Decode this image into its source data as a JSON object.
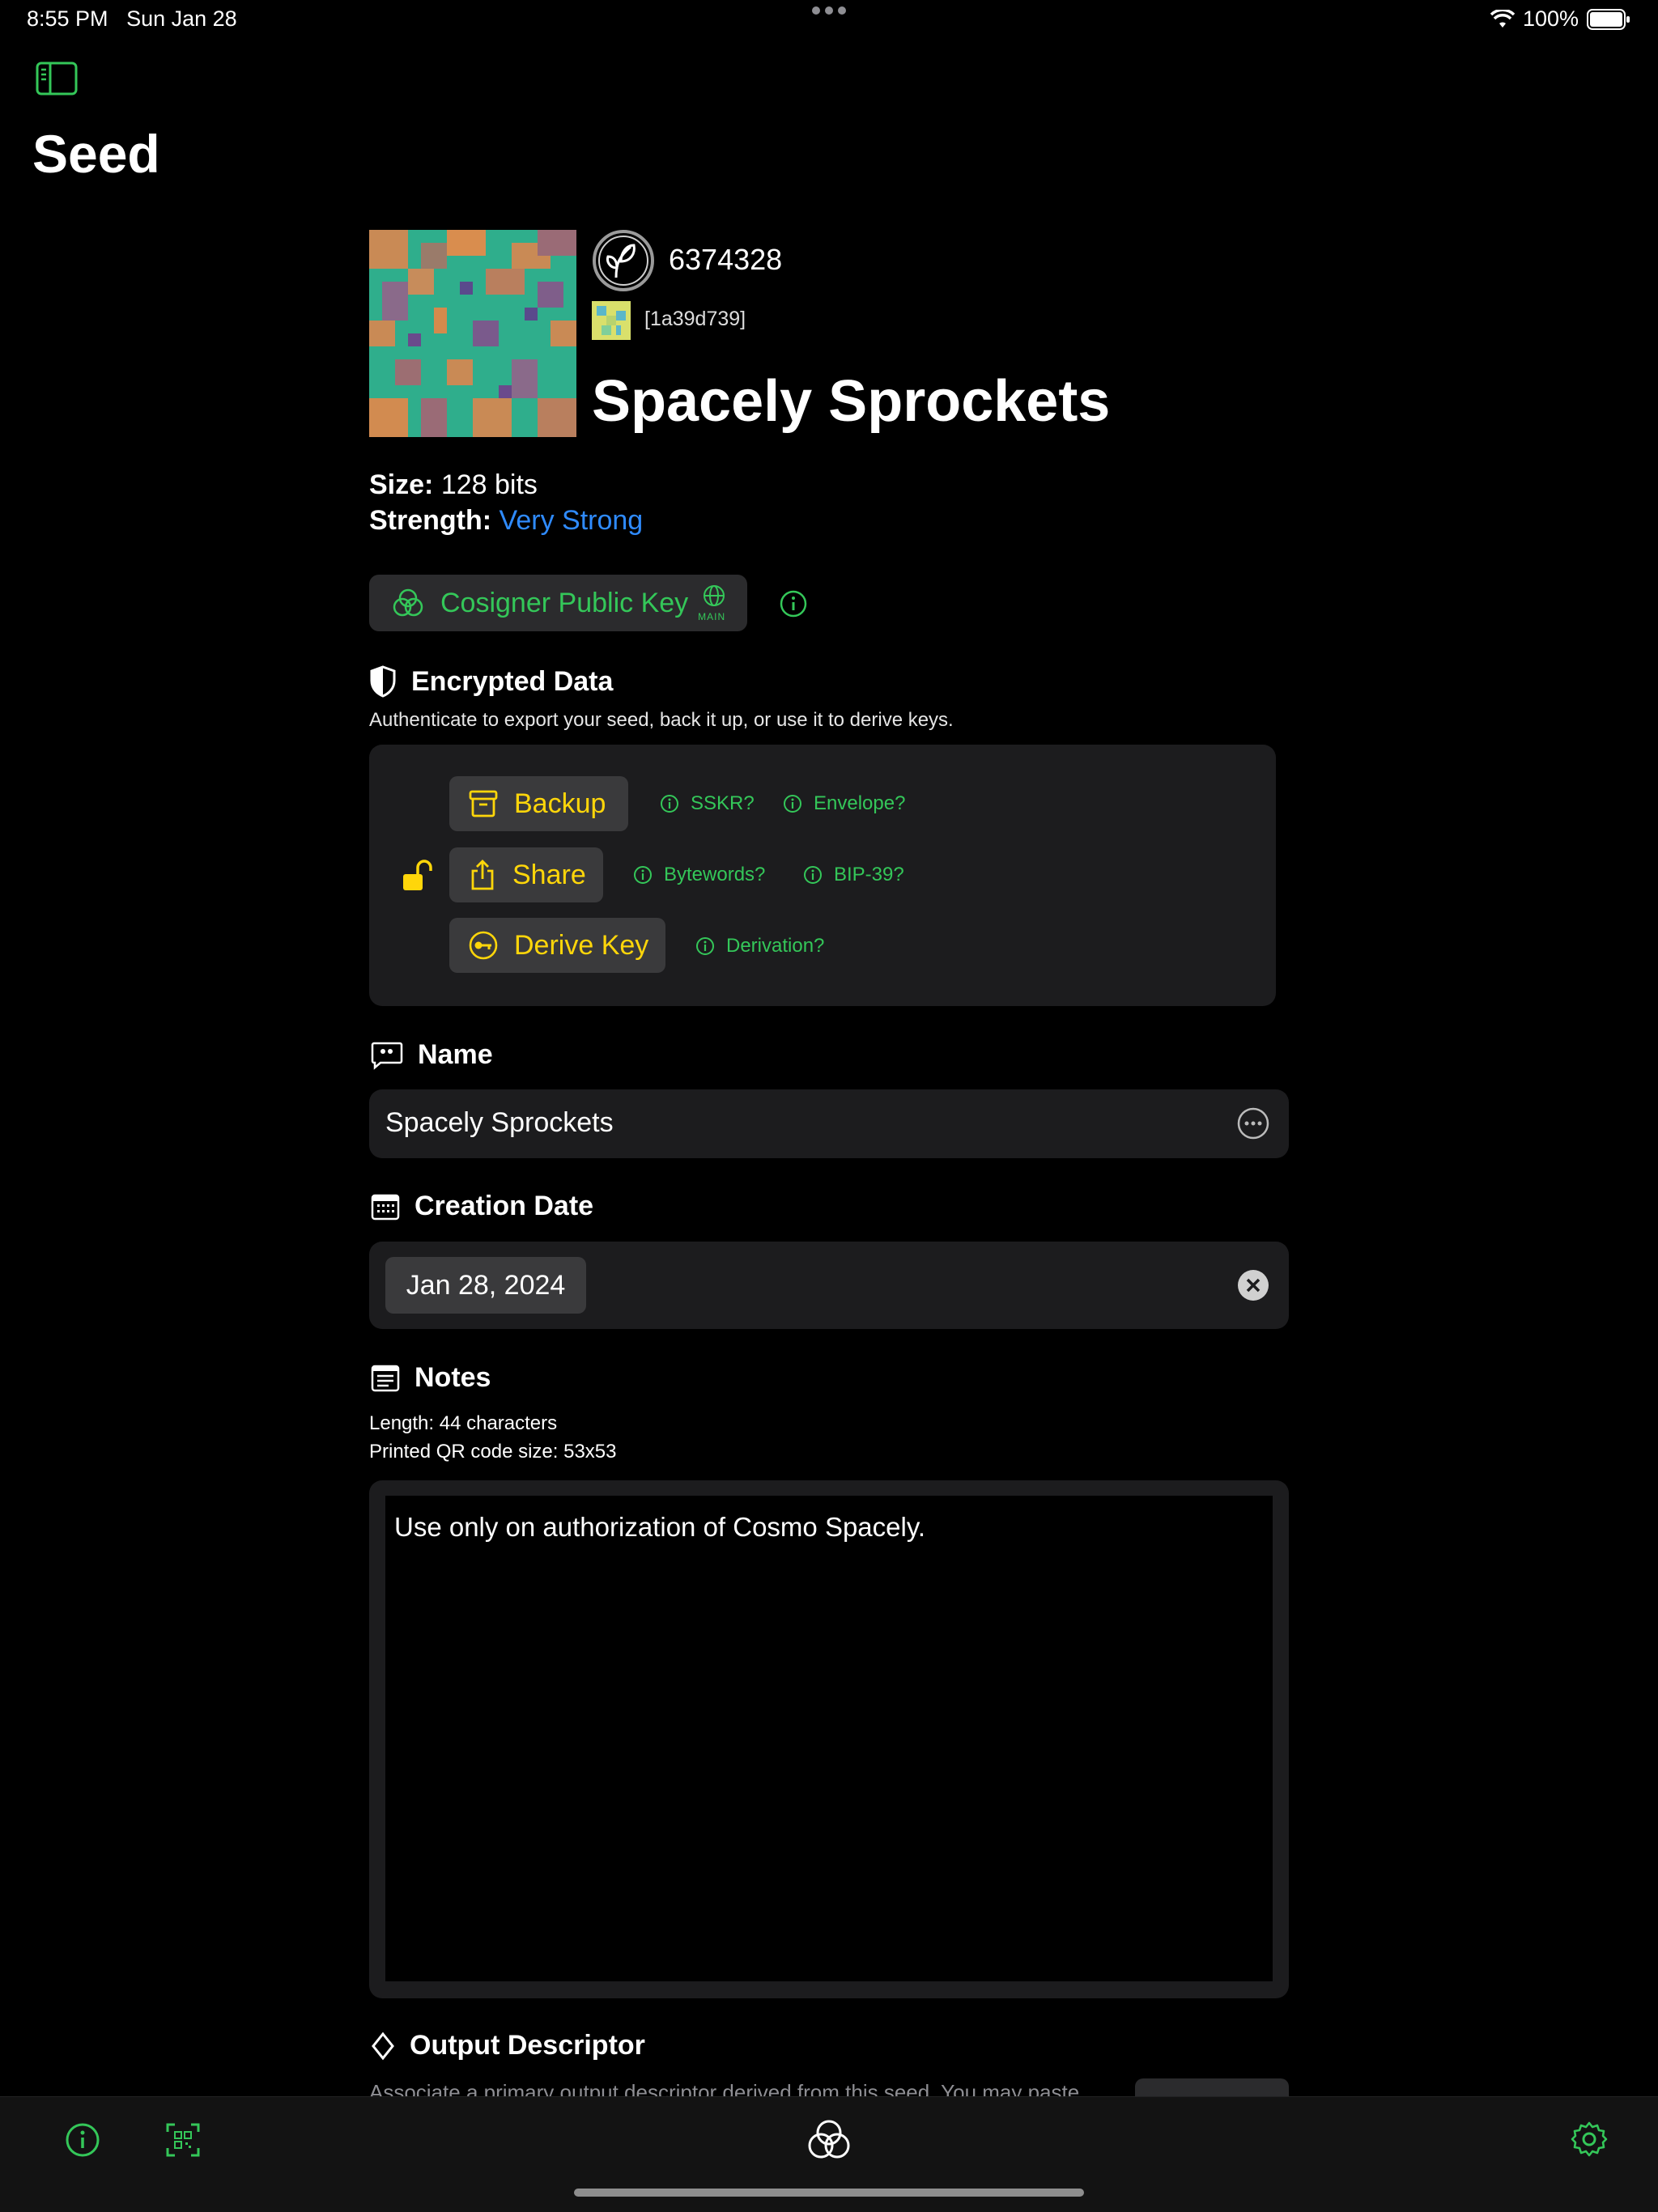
{
  "status_bar": {
    "time": "8:55 PM",
    "date": "Sun Jan 28",
    "battery": "100%"
  },
  "page": {
    "title": "Seed"
  },
  "seed": {
    "number": "6374328",
    "fingerprint": "[1a39d739]",
    "name": "Spacely Sprockets",
    "size_label": "Size:",
    "size_value": "128 bits",
    "strength_label": "Strength:",
    "strength_value": "Very Strong"
  },
  "cosigner": {
    "label": "Cosigner Public Key",
    "network": "MAIN"
  },
  "encrypted": {
    "title": "Encrypted Data",
    "subtitle": "Authenticate to export your seed, back it up, or use it to derive keys.",
    "actions": [
      {
        "label": "Backup",
        "hints": [
          "SSKR?",
          "Envelope?"
        ]
      },
      {
        "label": "Share",
        "hints": [
          "Bytewords?",
          "BIP-39?"
        ]
      },
      {
        "label": "Derive Key",
        "hints": [
          "Derivation?"
        ]
      }
    ]
  },
  "name_section": {
    "title": "Name",
    "value": "Spacely Sprockets"
  },
  "creation_date": {
    "title": "Creation Date",
    "value": "Jan 28, 2024"
  },
  "notes": {
    "title": "Notes",
    "length": "Length: 44 characters",
    "qr_size": "Printed QR code size: 53x53",
    "text": "Use only on authorization of Cosmo Spacely."
  },
  "output_descriptor": {
    "title": "Output Descriptor",
    "subtitle": "Associate a primary output descriptor derived from this seed. You may paste"
  },
  "colors": {
    "accent_green": "#34c759",
    "action_yellow": "#ffd60a",
    "link_blue": "#2f8bff"
  },
  "icons": [
    "sidebar-toggle-icon",
    "leaf-icon",
    "info-icon",
    "shield-icon",
    "lock-open-icon",
    "archive-box-icon",
    "share-icon",
    "key-icon",
    "quote-bubble-icon",
    "more-icon",
    "calendar-icon",
    "clear-icon",
    "notes-icon",
    "diamond-icon",
    "qr-scan-icon",
    "cosigner-logo-icon",
    "gear-icon"
  ]
}
